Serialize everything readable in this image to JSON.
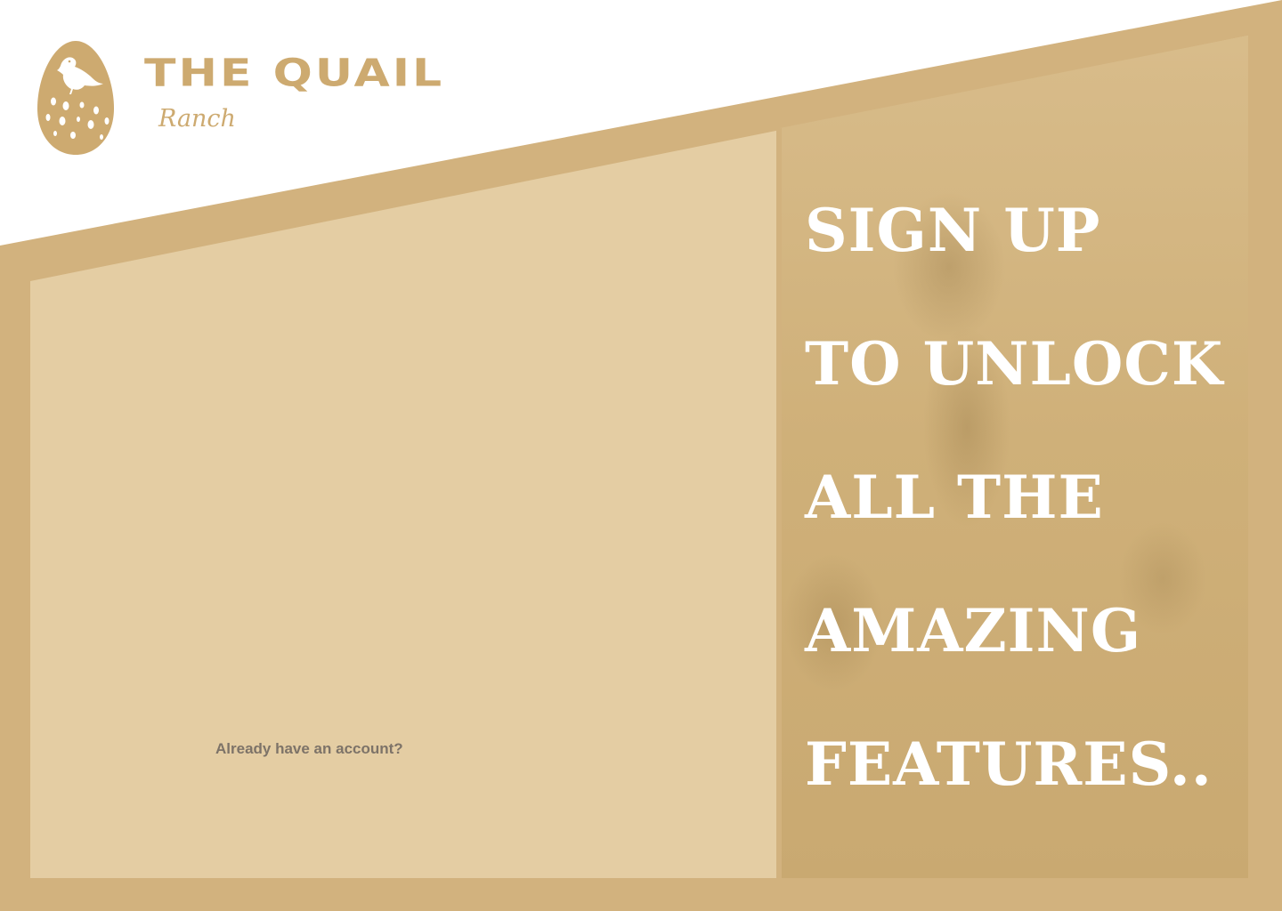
{
  "brand": {
    "title": "THE QUAIL",
    "subtitle": "Ranch",
    "logo_icon": "quail-egg-icon"
  },
  "promo": {
    "lines": [
      "SIGN UP",
      "TO UNLOCK",
      "ALL THE",
      "AMAZING",
      "FEATURES.."
    ]
  },
  "form": {
    "login_prompt": "Already have an account?"
  },
  "colors": {
    "band": "#d2b27e",
    "panel": "#e4cda3",
    "brand": "#cdaa70",
    "headline": "#ffffff",
    "link_text": "#7d7368"
  }
}
